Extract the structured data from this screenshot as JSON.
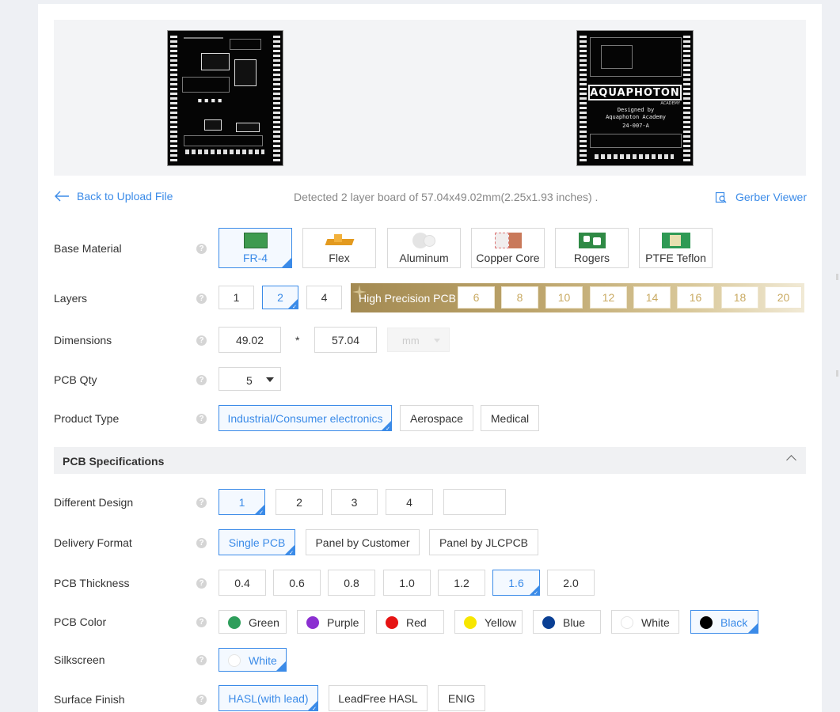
{
  "nav": {
    "back_label": "Back to Upload File",
    "detected_text": "Detected 2 layer board of 57.04x49.02mm(2.25x1.93 inches) .",
    "gerber_label": "Gerber Viewer"
  },
  "preview": {
    "bottom_logo": "AQUAPHOTON",
    "bottom_logo_sub": "ACADEMY",
    "bottom_line1": "Designed by",
    "bottom_line2": "Aquaphoton Academy",
    "bottom_line3": "24-007-A"
  },
  "base_material": {
    "label": "Base Material",
    "options": [
      "FR-4",
      "Flex",
      "Aluminum",
      "Copper Core",
      "Rogers",
      "PTFE Teflon"
    ],
    "selected": "FR-4"
  },
  "layers": {
    "label": "Layers",
    "options": [
      "1",
      "2",
      "4"
    ],
    "selected": "2",
    "high_precision_label": "High Precision PCB",
    "high_precision_options": [
      "6",
      "8",
      "10",
      "12",
      "14",
      "16",
      "18",
      "20"
    ]
  },
  "dimensions": {
    "label": "Dimensions",
    "width": "49.02",
    "separator": "*",
    "height": "57.04",
    "unit": "mm"
  },
  "pcb_qty": {
    "label": "PCB Qty",
    "value": "5"
  },
  "product_type": {
    "label": "Product Type",
    "options": [
      "Industrial/Consumer electronics",
      "Aerospace",
      "Medical"
    ],
    "selected": "Industrial/Consumer electronics"
  },
  "spec_section": {
    "title": "PCB Specifications"
  },
  "different_design": {
    "label": "Different Design",
    "options": [
      "1",
      "2",
      "3",
      "4"
    ],
    "custom_value": "",
    "selected": "1"
  },
  "delivery_format": {
    "label": "Delivery Format",
    "options": [
      "Single PCB",
      "Panel by Customer",
      "Panel by JLCPCB"
    ],
    "selected": "Single PCB"
  },
  "thickness": {
    "label": "PCB Thickness",
    "options": [
      "0.4",
      "0.6",
      "0.8",
      "1.0",
      "1.2",
      "1.6",
      "2.0"
    ],
    "selected": "1.6"
  },
  "pcb_color": {
    "label": "PCB Color",
    "options": [
      {
        "name": "Green",
        "color": "#2e9e5b"
      },
      {
        "name": "Purple",
        "color": "#8b2fd1"
      },
      {
        "name": "Red",
        "color": "#e61414"
      },
      {
        "name": "Yellow",
        "color": "#f7e600"
      },
      {
        "name": "Blue",
        "color": "#0a3f94"
      },
      {
        "name": "White",
        "color": "#ffffff"
      },
      {
        "name": "Black",
        "color": "#000000"
      }
    ],
    "selected": "Black"
  },
  "silkscreen": {
    "label": "Silkscreen",
    "options": [
      "White"
    ],
    "selected": "White"
  },
  "surface_finish": {
    "label": "Surface Finish",
    "options": [
      "HASL(with lead)",
      "LeadFree HASL",
      "ENIG"
    ],
    "selected": "HASL(with lead)"
  },
  "colors": {
    "accent": "#3b8be8",
    "gold": "#bca46b"
  }
}
